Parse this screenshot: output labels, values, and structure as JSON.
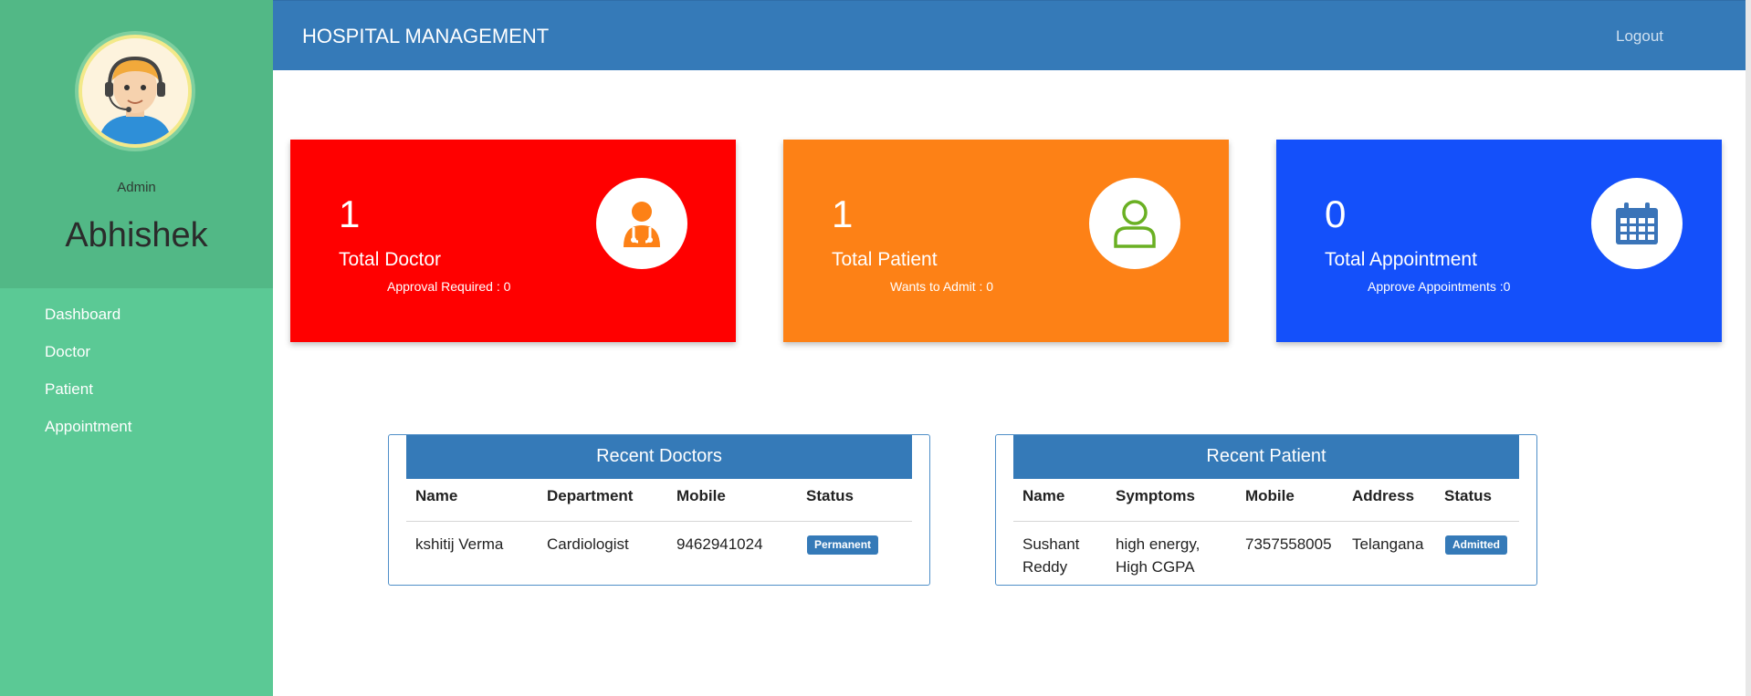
{
  "sidebar": {
    "role": "Admin",
    "username": "Abhishek",
    "items": [
      {
        "label": "Dashboard"
      },
      {
        "label": "Doctor"
      },
      {
        "label": "Patient"
      },
      {
        "label": "Appointment"
      }
    ]
  },
  "header": {
    "title": "HOSPITAL MANAGEMENT",
    "logout": "Logout"
  },
  "cards": {
    "doctor": {
      "count": "1",
      "label": "Total Doctor",
      "sub": "Approval Required : 0",
      "icon": "doctor-icon",
      "color": "#ff0000"
    },
    "patient": {
      "count": "1",
      "label": "Total Patient",
      "sub": "Wants to Admit : 0",
      "icon": "user-icon",
      "color": "#fd8116"
    },
    "appointment": {
      "count": "0",
      "label": "Total Appointment",
      "sub": "Approve Appointments :0",
      "icon": "calendar-icon",
      "color": "#1450fa"
    }
  },
  "recent_doctors": {
    "title": "Recent Doctors",
    "columns": [
      "Name",
      "Department",
      "Mobile",
      "Status"
    ],
    "rows": [
      {
        "name": "kshitij Verma",
        "department": "Cardiologist",
        "mobile": "9462941024",
        "status": "Permanent"
      }
    ]
  },
  "recent_patients": {
    "title": "Recent Patient",
    "columns": [
      "Name",
      "Symptoms",
      "Mobile",
      "Address",
      "Status"
    ],
    "rows": [
      {
        "name_line1": "Sushant",
        "name_line2": "Reddy",
        "symptoms_line1": "high energy,",
        "symptoms_line2": "High CGPA",
        "mobile": "7357558005",
        "address": "Telangana",
        "status": "Admitted"
      }
    ]
  },
  "colors": {
    "sidebar": "#5bc995",
    "profile": "#52b886",
    "header": "#357ab8",
    "badge": "#357ab8"
  }
}
